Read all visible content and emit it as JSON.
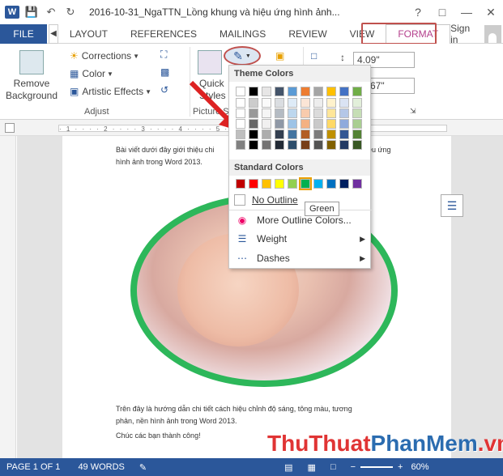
{
  "title_bar": {
    "doc_title": "2016-10-31_NgaTTN_Lồng khung và hiệu ứng hình ảnh...",
    "help": "?",
    "minimize": "—",
    "close": "✕"
  },
  "tabs": {
    "file": "FILE",
    "items": [
      "LAYOUT",
      "REFERENCES",
      "MAILINGS",
      "REVIEW",
      "VIEW"
    ],
    "format": "FORMAT",
    "sign_in": "Sign in"
  },
  "ribbon": {
    "remove_bg": "Remove Background",
    "corrections": "Corrections",
    "color": "Color",
    "artistic": "Artistic Effects",
    "adjust": "Adjust",
    "quick": "Quick",
    "styles": "Styles",
    "picture_styles": "Picture S",
    "height": "4.09\"",
    "width": "67\""
  },
  "ruler": {
    "marks": "· 1 · · · · 2 · · · · 3 · · · · 4 · · · · 5 · · · · 6 · · · · 7"
  },
  "document": {
    "intro": "Bài viết dưới đây giới thiệu chi tiết cách lồng khung và hiệu ứng hình ảnh trong Word 2013.",
    "intro_line1a": "Bài viết dưới đây giới thiệu chi",
    "intro_line1b": "iệu ứng",
    "intro_line2": "hình ảnh trong Word 2013.",
    "outro_line1": "Trên đây là hướng dẫn chi tiết cách hiệu chỉnh độ sáng, tông màu, tương",
    "outro_line2": "phản, nền hình ảnh trong Word 2013.",
    "closing": "Chúc các bạn thành công!"
  },
  "dropdown": {
    "theme_colors": "Theme Colors",
    "standard_colors": "Standard Colors",
    "no_outline": "No Outline",
    "more_colors": "More Outline Colors...",
    "weight": "Weight",
    "dashes": "Dashes",
    "tooltip": "Green",
    "theme_top": [
      "#ffffff",
      "#000000",
      "#e7e6e6",
      "#44546a",
      "#5b9bd5",
      "#ed7d31",
      "#a5a5a5",
      "#ffc000",
      "#4472c4",
      "#70ad47"
    ],
    "standard": [
      "#c00000",
      "#ff0000",
      "#ffc000",
      "#ffff00",
      "#92d050",
      "#00b050",
      "#00b0f0",
      "#0070c0",
      "#002060",
      "#7030a0"
    ]
  },
  "watermark": {
    "part1": "ThuThuat",
    "part2": "PhanMem",
    "part3": ".vn"
  },
  "status": {
    "page": "PAGE 1 OF 1",
    "words": "49 WORDS",
    "zoom": "60%"
  },
  "colors": {
    "accent": "#2b579a",
    "format_tab": "#b43f8c",
    "highlight": "#c0504d",
    "frame": "#2db75a"
  }
}
